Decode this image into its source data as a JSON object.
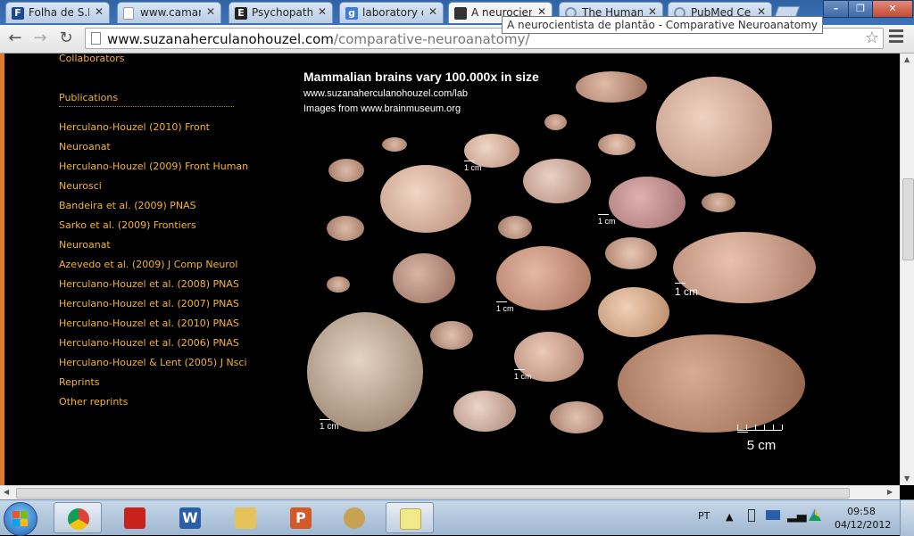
{
  "tabs": [
    {
      "label": "Folha de S.P",
      "icon": "folha-icon",
      "color": "#1a4a8a",
      "letter": "F"
    },
    {
      "label": "www.camar",
      "icon": "page-icon",
      "color": "#ffffff",
      "letter": ""
    },
    {
      "label": "Psychopaths",
      "icon": "e-icon",
      "color": "#222222",
      "letter": "E"
    },
    {
      "label": "laboratory o",
      "icon": "google-icon",
      "color": "#3d7bd6",
      "letter": "g"
    },
    {
      "label": "A neurocient",
      "icon": "cube-icon",
      "color": "#333333",
      "letter": ""
    },
    {
      "label": "The Human",
      "icon": "loading-icon",
      "color": "#ffffff",
      "letter": ""
    },
    {
      "label": "PubMed Cer",
      "icon": "loading-icon",
      "color": "#ffffff",
      "letter": ""
    }
  ],
  "tooltip": "A neurocientista de plantão - Comparative Neuroanatomy",
  "url": {
    "host": "www.suzanaherculanohouzel.com",
    "path": "/comparative-neuroanatomy/"
  },
  "sidebar": {
    "collaborators": "Collaborators",
    "publications_heading": "Publications",
    "items": [
      "Herculano-Houzel (2010) Front",
      "Neuroanat",
      "Herculano-Houzel (2009) Front Human",
      "Neurosci",
      "Bandeira et al. (2009) PNAS",
      "Sarko et al. (2009) Frontiers",
      "Neuroanat",
      "Azevedo et al. (2009) J Comp Neurol",
      "Herculano-Houzel et al. (2008) PNAS",
      "Herculano-Houzel et al. (2007) PNAS",
      "Herculano-Houzel et al. (2010) PNAS",
      "Herculano-Houzel et al. (2006) PNAS",
      "Herculano-Houzel & Lent (2005) J Nsci",
      "Reprints",
      "Other reprints"
    ]
  },
  "figure": {
    "title": "Mammalian brains vary 100.000x in size",
    "line1": "www.suzanaherculanohouzel.com/lab",
    "line2": "Images from www.brainmuseum.org",
    "scale_1cm": "1 cm",
    "scale_5cm": "5 cm"
  },
  "taskbar": {
    "apps": [
      {
        "name": "chrome",
        "icon": "chrome-icon"
      },
      {
        "name": "acrobat",
        "icon": "pdf-icon"
      },
      {
        "name": "word",
        "icon": "word-icon"
      },
      {
        "name": "explorer",
        "icon": "folder-icon"
      },
      {
        "name": "powerpoint",
        "icon": "powerpoint-icon"
      },
      {
        "name": "media",
        "icon": "media-player-icon"
      },
      {
        "name": "sticky-notes",
        "icon": "sticky-notes-icon"
      }
    ],
    "language": "PT",
    "time": "09:58",
    "date": "04/12/2012"
  },
  "colors": {
    "link": "#f2b32a",
    "accent_bar": "#e07a2a",
    "brain": "#c89a82"
  }
}
